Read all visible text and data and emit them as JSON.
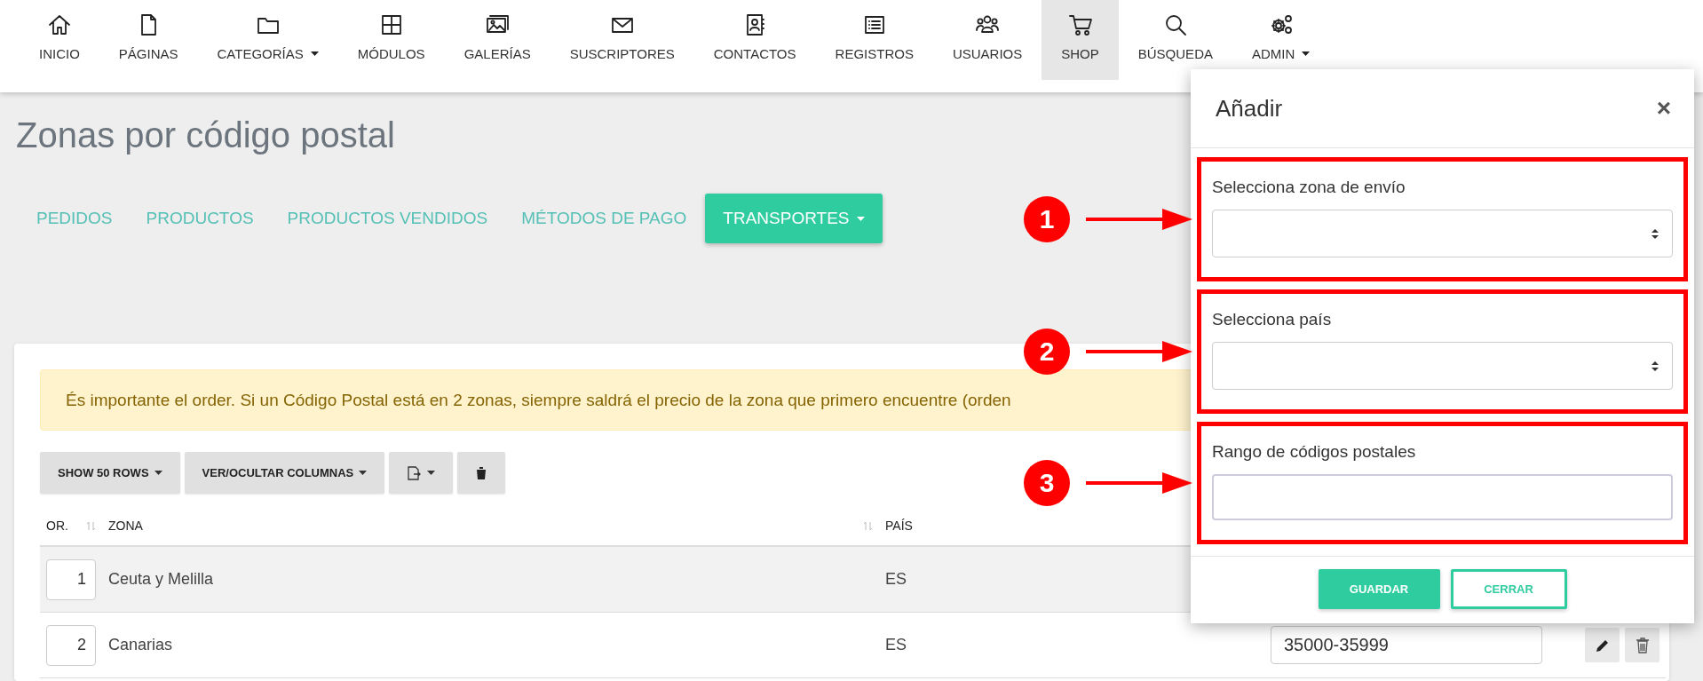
{
  "nav": {
    "items": [
      {
        "label": "INICIO",
        "selected": false,
        "dropdown": false
      },
      {
        "label": "PÁGINAS",
        "selected": false,
        "dropdown": false
      },
      {
        "label": "CATEGORÍAS",
        "selected": false,
        "dropdown": true
      },
      {
        "label": "MÓDULOS",
        "selected": false,
        "dropdown": false
      },
      {
        "label": "GALERÍAS",
        "selected": false,
        "dropdown": false
      },
      {
        "label": "SUSCRIPTORES",
        "selected": false,
        "dropdown": false
      },
      {
        "label": "CONTACTOS",
        "selected": false,
        "dropdown": false
      },
      {
        "label": "REGISTROS",
        "selected": false,
        "dropdown": false
      },
      {
        "label": "USUARIOS",
        "selected": false,
        "dropdown": false
      },
      {
        "label": "SHOP",
        "selected": true,
        "dropdown": false
      },
      {
        "label": "BÚSQUEDA",
        "selected": false,
        "dropdown": false
      },
      {
        "label": "ADMIN",
        "selected": false,
        "dropdown": true
      }
    ]
  },
  "page": {
    "title": "Zonas por código postal",
    "tabs": [
      {
        "label": "PEDIDOS",
        "selected": false,
        "dropdown": false
      },
      {
        "label": "PRODUCTOS",
        "selected": false,
        "dropdown": false
      },
      {
        "label": "PRODUCTOS VENDIDOS",
        "selected": false,
        "dropdown": false
      },
      {
        "label": "MÉTODOS DE PAGO",
        "selected": false,
        "dropdown": false
      },
      {
        "label": "TRANSPORTES",
        "selected": true,
        "dropdown": true
      }
    ]
  },
  "card": {
    "alert": "És importante el order. Si un Código Postal está en 2 zonas, siempre saldrá el precio de la zona que primero encuentre (orden",
    "toolbar": [
      {
        "kind": "text",
        "label": "SHOW 50 ROWS",
        "dropdown": true
      },
      {
        "kind": "text",
        "label": "VER/OCULTAR COLUMNAS",
        "dropdown": true
      },
      {
        "kind": "export",
        "dropdown": true
      },
      {
        "kind": "delete",
        "dropdown": false
      }
    ],
    "table": {
      "columns": [
        {
          "label": "OR.",
          "sortable": true
        },
        {
          "label": "ZONA",
          "sortable": true
        },
        {
          "label": "PAÍS"
        }
      ],
      "rows": [
        {
          "order": "1",
          "zone": "Ceuta y Melilla",
          "country": "ES"
        },
        {
          "order": "2",
          "zone": "Canarias",
          "country": "ES",
          "range": "35000-35999",
          "actions": true
        }
      ]
    }
  },
  "modal": {
    "title": "Añadir",
    "close": "×",
    "fields": [
      {
        "label": "Selecciona zona de envío",
        "kind": "select",
        "marker": "1"
      },
      {
        "label": "Selecciona país",
        "kind": "select",
        "marker": "2"
      },
      {
        "label": "Rango de códigos postales",
        "kind": "text",
        "marker": "3"
      }
    ],
    "buttons": [
      {
        "label": "GUARDAR",
        "kind": "primary"
      },
      {
        "label": "CERRAR",
        "kind": "outline"
      }
    ]
  }
}
